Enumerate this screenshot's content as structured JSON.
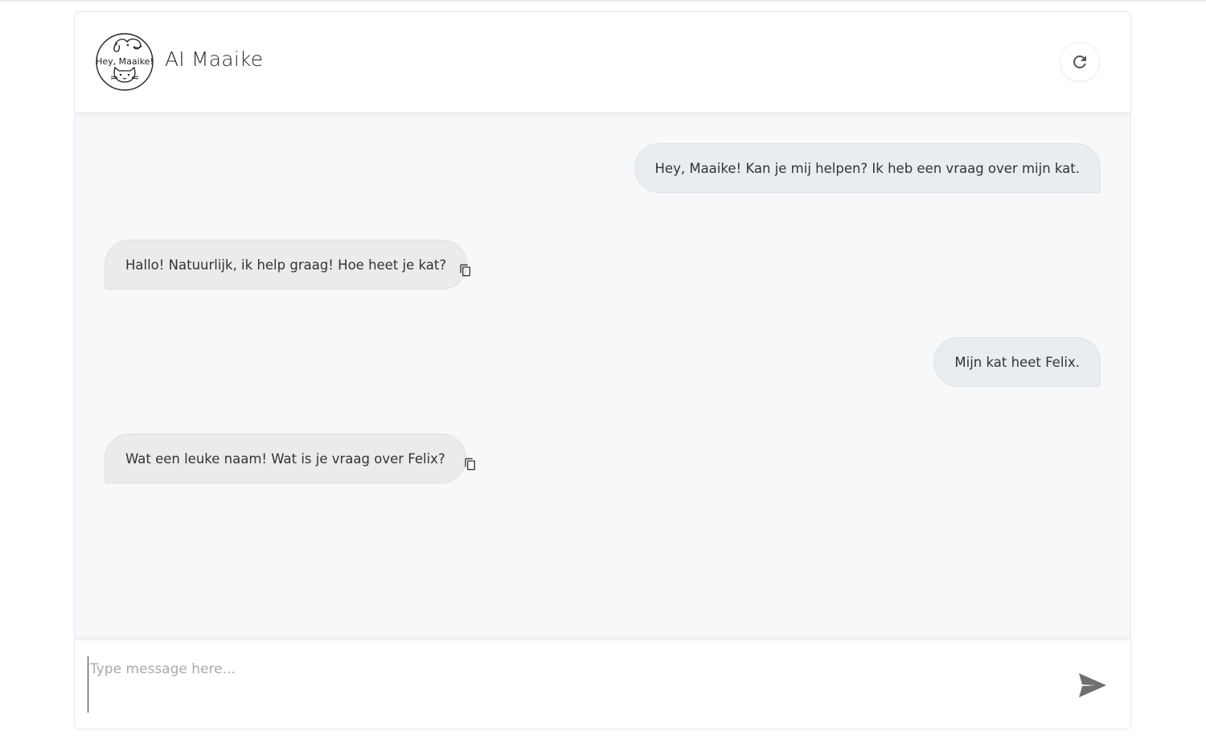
{
  "app": {
    "title": "AI Maaike",
    "logo_text": "Hey, Maaike!"
  },
  "header": {
    "refresh_icon": "refresh-icon"
  },
  "messages": [
    {
      "role": "user",
      "text": "Hey, Maaike! Kan je mij helpen? Ik heb een vraag over mijn kat."
    },
    {
      "role": "assistant",
      "text": "Hallo! Natuurlijk, ik help graag! Hoe heet je kat?"
    },
    {
      "role": "user",
      "text": "Mijn kat heet Felix."
    },
    {
      "role": "assistant",
      "text": "Wat een leuke naam! Wat is je vraag over Felix?"
    }
  ],
  "composer": {
    "placeholder": "Type message here...",
    "value": "",
    "send_icon": "send-icon"
  },
  "icons": {
    "copy": "copy-icon",
    "refresh": "refresh-icon",
    "send": "send-icon"
  },
  "colors": {
    "chat_background": "#f7f8fa",
    "user_bubble": "#e9edf0",
    "bot_bubble": "#eaebed",
    "send_icon": "#6f6f6f"
  }
}
